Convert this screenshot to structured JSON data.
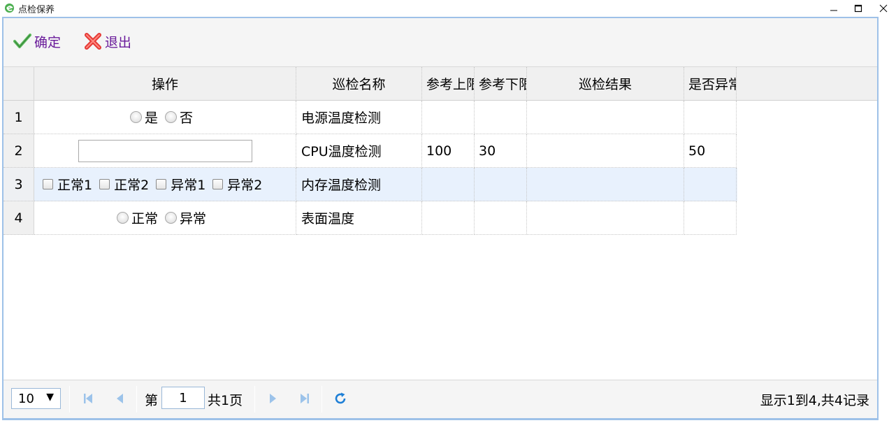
{
  "window": {
    "title": "点检保养"
  },
  "toolbar": {
    "ok_label": "确定",
    "exit_label": "退出"
  },
  "grid": {
    "headers": [
      "操作",
      "巡检名称",
      "参考上限",
      "参考下限",
      "巡检结果",
      "是否异常"
    ],
    "rows": [
      {
        "num": "1",
        "name": "电源温度检测",
        "upper": "",
        "lower": "",
        "result": "",
        "abnormal": "",
        "op": {
          "type": "radio",
          "options": [
            "是",
            "否"
          ]
        }
      },
      {
        "num": "2",
        "name": "CPU温度检测",
        "upper": "100",
        "lower": "30",
        "result": "",
        "abnormal": "50",
        "op": {
          "type": "text",
          "value": ""
        }
      },
      {
        "num": "3",
        "name": "内存温度检测",
        "upper": "",
        "lower": "",
        "result": "",
        "abnormal": "",
        "op": {
          "type": "checkbox",
          "options": [
            "正常1",
            "正常2",
            "异常1",
            "异常2"
          ]
        }
      },
      {
        "num": "4",
        "name": "表面温度",
        "upper": "",
        "lower": "",
        "result": "",
        "abnormal": "",
        "op": {
          "type": "radio",
          "options": [
            "正常",
            "异常"
          ]
        }
      }
    ]
  },
  "pager": {
    "page_size": "10",
    "page_prefix": "第",
    "page_number": "1",
    "page_total": "共1页",
    "info": "显示1到4,共4记录"
  },
  "colors": {
    "accent": "#9ec1e8",
    "toolbar_text": "#6a1b9a",
    "selected_row": "#e8f1fd"
  }
}
